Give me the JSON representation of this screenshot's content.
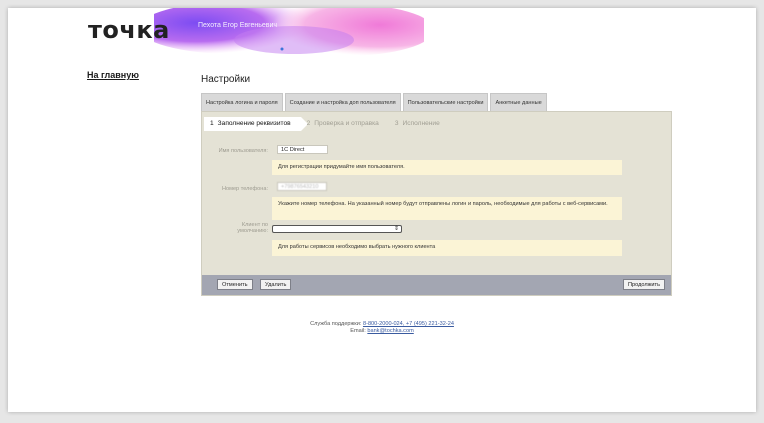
{
  "brand": {
    "logo": "точка",
    "user_name": "Пехота Егор Евгеньевич"
  },
  "nav": {
    "home_link": "На главную"
  },
  "page": {
    "title": "Настройки"
  },
  "tabs": [
    {
      "label": "Настройка логина и пароля"
    },
    {
      "label": "Создание и настройка доп пользователя"
    },
    {
      "label": "Пользовательские настройки"
    },
    {
      "label": "Анкетные данные"
    }
  ],
  "steps": [
    {
      "num": "1",
      "label": "Заполнение реквизитов"
    },
    {
      "num": "2",
      "label": "Проверка и отправка"
    },
    {
      "num": "3",
      "label": "Исполнение"
    }
  ],
  "form": {
    "username_label": "Имя пользователя:",
    "username_value": "1C Direct",
    "username_hint": "Для регистрации придумайте имя пользователя.",
    "phone_label": "Номер телефона:",
    "phone_value": "+79876543210",
    "phone_hint": "Укажите номер телефона. На указанный номер будут отправлены логин и пароль, необходимые для работы с веб-сервисами.",
    "client_label_1": "Клиент по",
    "client_label_2": "умолчанию:",
    "client_hint": "Для работы сервисов необходимо выбрать нужного клиента"
  },
  "buttons": {
    "cancel": "Отменить",
    "delete": "Удалить",
    "continue": "Продолжить"
  },
  "footer": {
    "support_label": "Служба поддержки:",
    "support_phones": "8-800-2000-024, +7 (495) 221-32-24",
    "email_label": "Email:",
    "email": "bank@tochka.com"
  }
}
